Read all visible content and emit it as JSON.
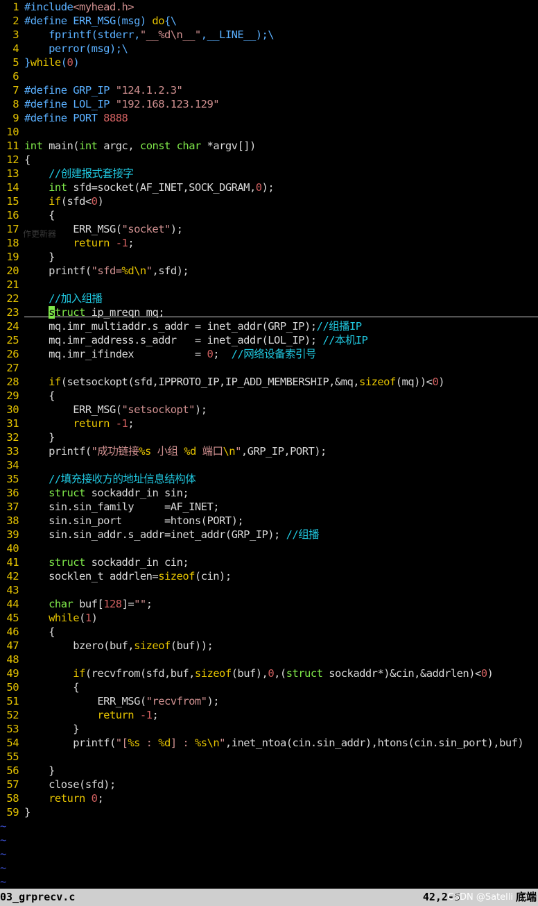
{
  "colors": {
    "background": "#000000",
    "line_number": "#e5c300",
    "text": "#d8d8d8",
    "comment": "#20c8e0",
    "keyword": "#e5c300",
    "type": "#7fe84a",
    "string": "#d09090",
    "number": "#d06060",
    "preproc": "#5ab0ff",
    "tilde": "#3b4fd0",
    "statusbar_bg": "#cfcfcf"
  },
  "lines": [
    {
      "n": "1",
      "tokens": [
        {
          "t": "#include",
          "c": "preproc"
        },
        {
          "t": "<myhead.h>",
          "c": "string"
        }
      ]
    },
    {
      "n": "2",
      "tokens": [
        {
          "t": "#define ERR_MSG(msg) ",
          "c": "preproc"
        },
        {
          "t": "do",
          "c": "keyword"
        },
        {
          "t": "{\\",
          "c": "preproc"
        }
      ]
    },
    {
      "n": "3",
      "tokens": [
        {
          "t": "    fprintf(stderr,",
          "c": "preproc"
        },
        {
          "t": "\"__%d\\n__\"",
          "c": "string"
        },
        {
          "t": ",__LINE__);\\",
          "c": "preproc"
        }
      ]
    },
    {
      "n": "4",
      "tokens": [
        {
          "t": "    perror(msg);\\",
          "c": "preproc"
        }
      ]
    },
    {
      "n": "5",
      "tokens": [
        {
          "t": "}",
          "c": "preproc"
        },
        {
          "t": "while",
          "c": "keyword"
        },
        {
          "t": "(",
          "c": "preproc"
        },
        {
          "t": "0",
          "c": "number"
        },
        {
          "t": ")",
          "c": "preproc"
        }
      ]
    },
    {
      "n": "6",
      "tokens": []
    },
    {
      "n": "7",
      "tokens": [
        {
          "t": "#define GRP_IP ",
          "c": "preproc"
        },
        {
          "t": "\"124.1.2.3\"",
          "c": "string"
        }
      ]
    },
    {
      "n": "8",
      "tokens": [
        {
          "t": "#define LOL_IP ",
          "c": "preproc"
        },
        {
          "t": "\"192.168.123.129\"",
          "c": "string"
        }
      ]
    },
    {
      "n": "9",
      "tokens": [
        {
          "t": "#define PORT ",
          "c": "preproc"
        },
        {
          "t": "8888",
          "c": "number"
        }
      ]
    },
    {
      "n": "10",
      "tokens": []
    },
    {
      "n": "11",
      "tokens": [
        {
          "t": "int",
          "c": "type"
        },
        {
          "t": " main(",
          "c": "text"
        },
        {
          "t": "int",
          "c": "type"
        },
        {
          "t": " argc, ",
          "c": "text"
        },
        {
          "t": "const",
          "c": "type"
        },
        {
          "t": " ",
          "c": "text"
        },
        {
          "t": "char",
          "c": "type"
        },
        {
          "t": " *argv[])",
          "c": "text"
        }
      ]
    },
    {
      "n": "12",
      "tokens": [
        {
          "t": "{",
          "c": "text"
        }
      ]
    },
    {
      "n": "13",
      "tokens": [
        {
          "t": "    ",
          "c": "text"
        },
        {
          "t": "//创建报式套接字",
          "c": "comment"
        }
      ]
    },
    {
      "n": "14",
      "tokens": [
        {
          "t": "    ",
          "c": "text"
        },
        {
          "t": "int",
          "c": "type"
        },
        {
          "t": " sfd=socket(AF_INET,SOCK_DGRAM,",
          "c": "text"
        },
        {
          "t": "0",
          "c": "number"
        },
        {
          "t": ");",
          "c": "text"
        }
      ]
    },
    {
      "n": "15",
      "tokens": [
        {
          "t": "    ",
          "c": "text"
        },
        {
          "t": "if",
          "c": "keyword"
        },
        {
          "t": "(sfd<",
          "c": "text"
        },
        {
          "t": "0",
          "c": "number"
        },
        {
          "t": ")",
          "c": "text"
        }
      ]
    },
    {
      "n": "16",
      "tokens": [
        {
          "t": "    {",
          "c": "text"
        }
      ]
    },
    {
      "n": "17",
      "tokens": [
        {
          "t": "        ERR_MSG(",
          "c": "text"
        },
        {
          "t": "\"socket\"",
          "c": "string"
        },
        {
          "t": ");",
          "c": "text"
        }
      ]
    },
    {
      "n": "18",
      "tokens": [
        {
          "t": "        ",
          "c": "text"
        },
        {
          "t": "return",
          "c": "keyword"
        },
        {
          "t": " ",
          "c": "text"
        },
        {
          "t": "-1",
          "c": "number"
        },
        {
          "t": ";",
          "c": "text"
        }
      ]
    },
    {
      "n": "19",
      "tokens": [
        {
          "t": "    }",
          "c": "text"
        }
      ]
    },
    {
      "n": "20",
      "tokens": [
        {
          "t": "    printf(",
          "c": "text"
        },
        {
          "t": "\"sfd=",
          "c": "string"
        },
        {
          "t": "%d\\n",
          "c": "keyword"
        },
        {
          "t": "\"",
          "c": "string"
        },
        {
          "t": ",sfd);",
          "c": "text"
        }
      ]
    },
    {
      "n": "21",
      "tokens": []
    },
    {
      "n": "22",
      "tokens": [
        {
          "t": "    ",
          "c": "text"
        },
        {
          "t": "//加入组播",
          "c": "comment"
        }
      ]
    },
    {
      "n": "23",
      "tokens": [
        {
          "t": "    ",
          "c": "text"
        },
        {
          "t": "s",
          "c": "cursor"
        },
        {
          "t": "truct",
          "c": "type"
        },
        {
          "t": " ip_mreqn mq;",
          "c": "text"
        }
      ]
    },
    {
      "n": "24",
      "tokens": [
        {
          "t": "    mq.imr_multiaddr.s_addr = inet_addr(GRP_IP);",
          "c": "text"
        },
        {
          "t": "//组播IP",
          "c": "comment"
        }
      ]
    },
    {
      "n": "25",
      "tokens": [
        {
          "t": "    mq.imr_address.s_addr   = inet_addr(LOL_IP); ",
          "c": "text"
        },
        {
          "t": "//本机IP",
          "c": "comment"
        }
      ]
    },
    {
      "n": "26",
      "tokens": [
        {
          "t": "    mq.imr_ifindex          = ",
          "c": "text"
        },
        {
          "t": "0",
          "c": "number"
        },
        {
          "t": ";  ",
          "c": "text"
        },
        {
          "t": "//网络设备索引号",
          "c": "comment"
        }
      ]
    },
    {
      "n": "27",
      "tokens": []
    },
    {
      "n": "28",
      "tokens": [
        {
          "t": "    ",
          "c": "text"
        },
        {
          "t": "if",
          "c": "keyword"
        },
        {
          "t": "(setsockopt(sfd,IPPROTO_IP,IP_ADD_MEMBERSHIP,&mq,",
          "c": "text"
        },
        {
          "t": "sizeof",
          "c": "keyword"
        },
        {
          "t": "(mq))<",
          "c": "text"
        },
        {
          "t": "0",
          "c": "number"
        },
        {
          "t": ")",
          "c": "text"
        }
      ]
    },
    {
      "n": "29",
      "tokens": [
        {
          "t": "    {",
          "c": "text"
        }
      ]
    },
    {
      "n": "30",
      "tokens": [
        {
          "t": "        ERR_MSG(",
          "c": "text"
        },
        {
          "t": "\"setsockopt\"",
          "c": "string"
        },
        {
          "t": ");",
          "c": "text"
        }
      ]
    },
    {
      "n": "31",
      "tokens": [
        {
          "t": "        ",
          "c": "text"
        },
        {
          "t": "return",
          "c": "keyword"
        },
        {
          "t": " ",
          "c": "text"
        },
        {
          "t": "-1",
          "c": "number"
        },
        {
          "t": ";",
          "c": "text"
        }
      ]
    },
    {
      "n": "32",
      "tokens": [
        {
          "t": "    }",
          "c": "text"
        }
      ]
    },
    {
      "n": "33",
      "tokens": [
        {
          "t": "    printf(",
          "c": "text"
        },
        {
          "t": "\"成功链接",
          "c": "string"
        },
        {
          "t": "%s",
          "c": "keyword"
        },
        {
          "t": " 小组 ",
          "c": "string"
        },
        {
          "t": "%d",
          "c": "keyword"
        },
        {
          "t": " 端口",
          "c": "string"
        },
        {
          "t": "\\n",
          "c": "keyword"
        },
        {
          "t": "\"",
          "c": "string"
        },
        {
          "t": ",GRP_IP,PORT);",
          "c": "text"
        }
      ]
    },
    {
      "n": "34",
      "tokens": []
    },
    {
      "n": "35",
      "tokens": [
        {
          "t": "    ",
          "c": "text"
        },
        {
          "t": "//填充接收方的地址信息结构体",
          "c": "comment"
        }
      ]
    },
    {
      "n": "36",
      "tokens": [
        {
          "t": "    ",
          "c": "text"
        },
        {
          "t": "struct",
          "c": "type"
        },
        {
          "t": " sockaddr_in sin;",
          "c": "text"
        }
      ]
    },
    {
      "n": "37",
      "tokens": [
        {
          "t": "    sin.sin_family     =AF_INET;",
          "c": "text"
        }
      ]
    },
    {
      "n": "38",
      "tokens": [
        {
          "t": "    sin.sin_port       =htons(PORT);",
          "c": "text"
        }
      ]
    },
    {
      "n": "39",
      "tokens": [
        {
          "t": "    sin.sin_addr.s_addr=inet_addr(GRP_IP); ",
          "c": "text"
        },
        {
          "t": "//组播",
          "c": "comment"
        }
      ]
    },
    {
      "n": "40",
      "tokens": []
    },
    {
      "n": "41",
      "tokens": [
        {
          "t": "    ",
          "c": "text"
        },
        {
          "t": "struct",
          "c": "type"
        },
        {
          "t": " sockaddr_in cin;",
          "c": "text"
        }
      ]
    },
    {
      "n": "42",
      "tokens": [
        {
          "t": "    socklen_t addrlen=",
          "c": "text"
        },
        {
          "t": "sizeof",
          "c": "keyword"
        },
        {
          "t": "(cin);",
          "c": "text"
        }
      ]
    },
    {
      "n": "43",
      "tokens": []
    },
    {
      "n": "44",
      "tokens": [
        {
          "t": "    ",
          "c": "text"
        },
        {
          "t": "char",
          "c": "type"
        },
        {
          "t": " buf[",
          "c": "text"
        },
        {
          "t": "128",
          "c": "number"
        },
        {
          "t": "]=",
          "c": "text"
        },
        {
          "t": "\"\"",
          "c": "string"
        },
        {
          "t": ";",
          "c": "text"
        }
      ]
    },
    {
      "n": "45",
      "tokens": [
        {
          "t": "    ",
          "c": "text"
        },
        {
          "t": "while",
          "c": "keyword"
        },
        {
          "t": "(",
          "c": "text"
        },
        {
          "t": "1",
          "c": "number"
        },
        {
          "t": ")",
          "c": "text"
        }
      ]
    },
    {
      "n": "46",
      "tokens": [
        {
          "t": "    {",
          "c": "text"
        }
      ]
    },
    {
      "n": "47",
      "tokens": [
        {
          "t": "        bzero(buf,",
          "c": "text"
        },
        {
          "t": "sizeof",
          "c": "keyword"
        },
        {
          "t": "(buf));",
          "c": "text"
        }
      ]
    },
    {
      "n": "48",
      "tokens": []
    },
    {
      "n": "49",
      "tokens": [
        {
          "t": "        ",
          "c": "text"
        },
        {
          "t": "if",
          "c": "keyword"
        },
        {
          "t": "(recvfrom(sfd,buf,",
          "c": "text"
        },
        {
          "t": "sizeof",
          "c": "keyword"
        },
        {
          "t": "(buf),",
          "c": "text"
        },
        {
          "t": "0",
          "c": "number"
        },
        {
          "t": ",(",
          "c": "text"
        },
        {
          "t": "struct",
          "c": "type"
        },
        {
          "t": " sockaddr*)&cin,&addrlen)<",
          "c": "text"
        },
        {
          "t": "0",
          "c": "number"
        },
        {
          "t": ")",
          "c": "text"
        }
      ]
    },
    {
      "n": "50",
      "tokens": [
        {
          "t": "        {",
          "c": "text"
        }
      ]
    },
    {
      "n": "51",
      "tokens": [
        {
          "t": "            ERR_MSG(",
          "c": "text"
        },
        {
          "t": "\"recvfrom\"",
          "c": "string"
        },
        {
          "t": ");",
          "c": "text"
        }
      ]
    },
    {
      "n": "52",
      "tokens": [
        {
          "t": "            ",
          "c": "text"
        },
        {
          "t": "return",
          "c": "keyword"
        },
        {
          "t": " ",
          "c": "text"
        },
        {
          "t": "-1",
          "c": "number"
        },
        {
          "t": ";",
          "c": "text"
        }
      ]
    },
    {
      "n": "53",
      "tokens": [
        {
          "t": "        }",
          "c": "text"
        }
      ]
    },
    {
      "n": "54",
      "tokens": [
        {
          "t": "        printf(",
          "c": "text"
        },
        {
          "t": "\"[",
          "c": "string"
        },
        {
          "t": "%s",
          "c": "keyword"
        },
        {
          "t": " : ",
          "c": "string"
        },
        {
          "t": "%d",
          "c": "keyword"
        },
        {
          "t": "] : ",
          "c": "string"
        },
        {
          "t": "%s\\n",
          "c": "keyword"
        },
        {
          "t": "\"",
          "c": "string"
        },
        {
          "t": ",inet_ntoa(cin.sin_addr),htons(cin.sin_port),buf)",
          "c": "text"
        }
      ]
    },
    {
      "n": "55",
      "tokens": []
    },
    {
      "n": "56",
      "tokens": [
        {
          "t": "    }",
          "c": "text"
        }
      ]
    },
    {
      "n": "57",
      "tokens": [
        {
          "t": "    close(sfd);",
          "c": "text"
        }
      ]
    },
    {
      "n": "58",
      "tokens": [
        {
          "t": "    ",
          "c": "text"
        },
        {
          "t": "return",
          "c": "keyword"
        },
        {
          "t": " ",
          "c": "text"
        },
        {
          "t": "0",
          "c": "number"
        },
        {
          "t": ";",
          "c": "text"
        }
      ]
    },
    {
      "n": "59",
      "tokens": [
        {
          "t": "}",
          "c": "text"
        }
      ]
    }
  ],
  "tilde_lines": [
    "~",
    "~",
    "~",
    "~",
    "~"
  ],
  "ghost_text": "作更新器",
  "statusbar": {
    "filename": "03_grprecv.c",
    "position": "42,2-5",
    "watermark": "CSDN @Satelli",
    "scroll": "底端"
  }
}
